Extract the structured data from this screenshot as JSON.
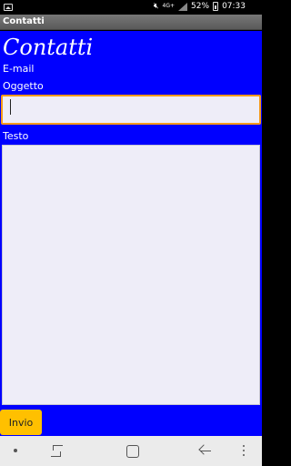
{
  "status_bar": {
    "icons": [
      "gallery-icon",
      "mute-icon",
      "network-4g-icon",
      "signal-icon",
      "battery-icon"
    ],
    "network_type": "4G+",
    "battery": "52%",
    "time": "07:33"
  },
  "action_bar": {
    "title": "Contatti"
  },
  "form": {
    "heading": "Contatti",
    "email_label": "E-mail",
    "oggetto_label": "Oggetto",
    "oggetto_value": "",
    "testo_label": "Testo",
    "testo_value": "",
    "submit_label": "Invio"
  },
  "nav_bar": {
    "icons": [
      "dot-icon",
      "recent-apps-icon",
      "home-icon",
      "back-icon",
      "more-icon"
    ]
  },
  "colors": {
    "background": "#0000ff",
    "input_bg": "#eeedf8",
    "focus_border": "#f59a1a",
    "button": "#ffc000",
    "action_bar": "#666666"
  }
}
